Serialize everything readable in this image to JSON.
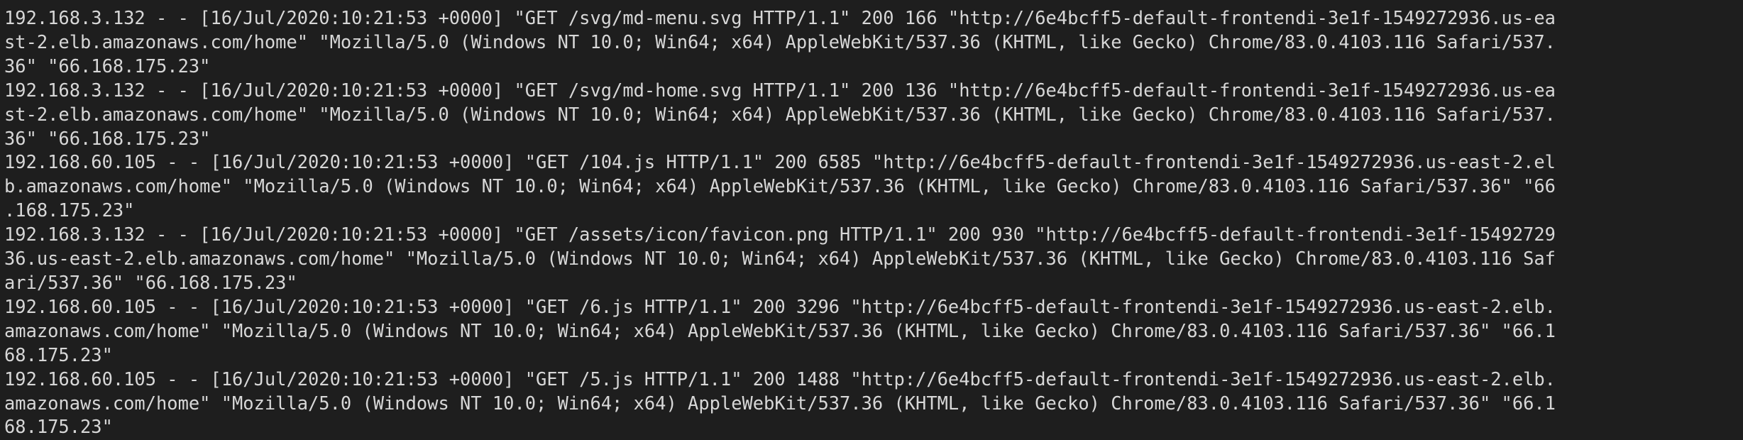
{
  "terminal": {
    "lines": [
      "192.168.3.132 - - [16/Jul/2020:10:21:53 +0000] \"GET /svg/md-menu.svg HTTP/1.1\" 200 166 \"http://6e4bcff5-default-frontendi-3e1f-1549272936.us-ea",
      "st-2.elb.amazonaws.com/home\" \"Mozilla/5.0 (Windows NT 10.0; Win64; x64) AppleWebKit/537.36 (KHTML, like Gecko) Chrome/83.0.4103.116 Safari/537.",
      "36\" \"66.168.175.23\"",
      "192.168.3.132 - - [16/Jul/2020:10:21:53 +0000] \"GET /svg/md-home.svg HTTP/1.1\" 200 136 \"http://6e4bcff5-default-frontendi-3e1f-1549272936.us-ea",
      "st-2.elb.amazonaws.com/home\" \"Mozilla/5.0 (Windows NT 10.0; Win64; x64) AppleWebKit/537.36 (KHTML, like Gecko) Chrome/83.0.4103.116 Safari/537.",
      "36\" \"66.168.175.23\"",
      "192.168.60.105 - - [16/Jul/2020:10:21:53 +0000] \"GET /104.js HTTP/1.1\" 200 6585 \"http://6e4bcff5-default-frontendi-3e1f-1549272936.us-east-2.el",
      "b.amazonaws.com/home\" \"Mozilla/5.0 (Windows NT 10.0; Win64; x64) AppleWebKit/537.36 (KHTML, like Gecko) Chrome/83.0.4103.116 Safari/537.36\" \"66",
      ".168.175.23\"",
      "192.168.3.132 - - [16/Jul/2020:10:21:53 +0000] \"GET /assets/icon/favicon.png HTTP/1.1\" 200 930 \"http://6e4bcff5-default-frontendi-3e1f-15492729",
      "36.us-east-2.elb.amazonaws.com/home\" \"Mozilla/5.0 (Windows NT 10.0; Win64; x64) AppleWebKit/537.36 (KHTML, like Gecko) Chrome/83.0.4103.116 Saf",
      "ari/537.36\" \"66.168.175.23\"",
      "192.168.60.105 - - [16/Jul/2020:10:21:53 +0000] \"GET /6.js HTTP/1.1\" 200 3296 \"http://6e4bcff5-default-frontendi-3e1f-1549272936.us-east-2.elb.",
      "amazonaws.com/home\" \"Mozilla/5.0 (Windows NT 10.0; Win64; x64) AppleWebKit/537.36 (KHTML, like Gecko) Chrome/83.0.4103.116 Safari/537.36\" \"66.1",
      "68.175.23\"",
      "192.168.60.105 - - [16/Jul/2020:10:21:53 +0000] \"GET /5.js HTTP/1.1\" 200 1488 \"http://6e4bcff5-default-frontendi-3e1f-1549272936.us-east-2.elb.",
      "amazonaws.com/home\" \"Mozilla/5.0 (Windows NT 10.0; Win64; x64) AppleWebKit/537.36 (KHTML, like Gecko) Chrome/83.0.4103.116 Safari/537.36\" \"66.1",
      "68.175.23\""
    ]
  }
}
